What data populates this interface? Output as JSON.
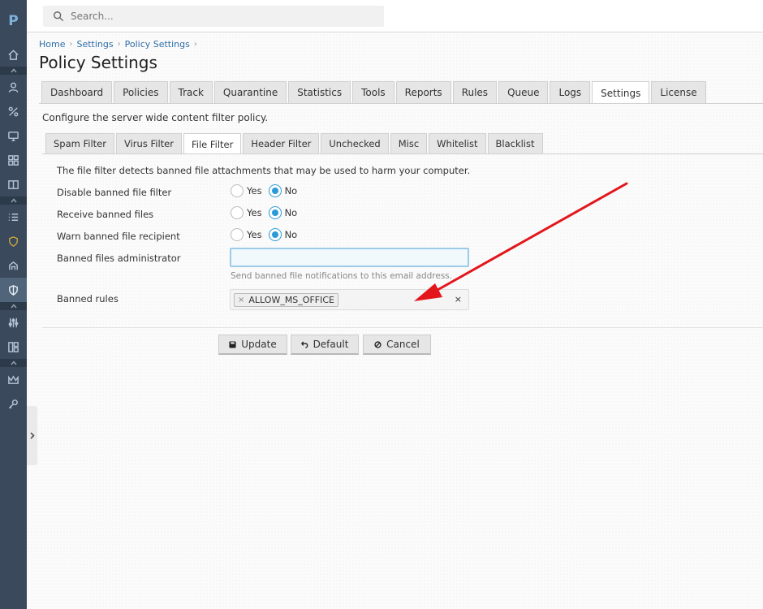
{
  "sidebar": {
    "logo": "P",
    "items": [
      {
        "icon": "home-icon"
      },
      {
        "icon": "user-icon"
      },
      {
        "icon": "percent-icon"
      },
      {
        "icon": "monitor-icon"
      },
      {
        "icon": "grid-icon"
      },
      {
        "icon": "book-icon"
      },
      {
        "icon": "list-icon"
      },
      {
        "icon": "shield-yellow-icon"
      },
      {
        "icon": "barn-icon"
      },
      {
        "icon": "shield-icon",
        "active": true
      },
      {
        "icon": "sliders-icon"
      },
      {
        "icon": "layout-icon"
      },
      {
        "icon": "crown-icon"
      },
      {
        "icon": "key-icon"
      }
    ]
  },
  "search": {
    "placeholder": "Search..."
  },
  "breadcrumb": [
    "Home",
    "Settings",
    "Policy Settings"
  ],
  "page_title": "Policy Settings",
  "main_tabs": [
    "Dashboard",
    "Policies",
    "Track",
    "Quarantine",
    "Statistics",
    "Tools",
    "Reports",
    "Rules",
    "Queue",
    "Logs",
    "Settings",
    "License"
  ],
  "main_tab_active": "Settings",
  "intro": "Configure the server wide content filter policy.",
  "sub_tabs": [
    "Spam Filter",
    "Virus Filter",
    "File Filter",
    "Header Filter",
    "Unchecked",
    "Misc",
    "Whitelist",
    "Blacklist"
  ],
  "sub_tab_active": "File Filter",
  "form": {
    "description": "The file filter detects banned file attachments that may be used to harm your computer.",
    "radio_yes": "Yes",
    "radio_no": "No",
    "rows": [
      {
        "label": "Disable banned file filter",
        "value": "No"
      },
      {
        "label": "Receive banned files",
        "value": "No"
      },
      {
        "label": "Warn banned file recipient",
        "value": "No"
      }
    ],
    "admin_label": "Banned files administrator",
    "admin_value": "",
    "admin_help": "Send banned file notifications to this email address.",
    "rules_label": "Banned rules",
    "rules_tags": [
      "ALLOW_MS_OFFICE"
    ],
    "tag_remove": "×",
    "clear": "×"
  },
  "buttons": {
    "update": "Update",
    "default": "Default",
    "cancel": "Cancel"
  },
  "colors": {
    "sidebar": "#3a4a5c",
    "accent": "#2a9ad8",
    "link": "#2d6da8",
    "annotation_arrow": "#e3161b"
  }
}
